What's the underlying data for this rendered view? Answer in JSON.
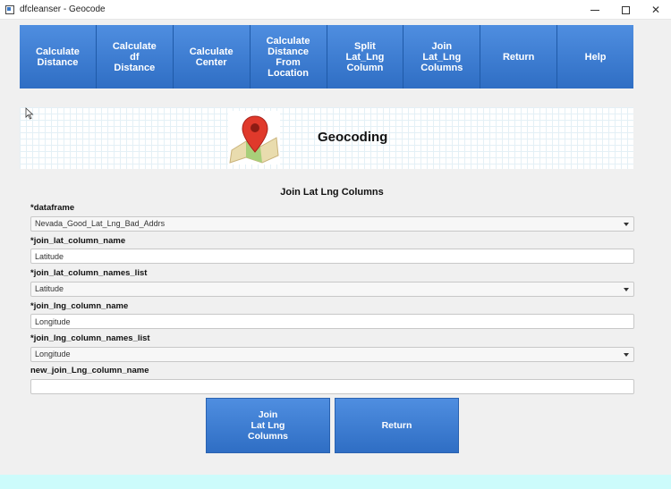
{
  "window": {
    "title": "dfcleanser - Geocode",
    "minimize": "—",
    "close": "✕"
  },
  "nav": [
    {
      "label": "Calculate\nDistance"
    },
    {
      "label": "Calculate\ndf\nDistance"
    },
    {
      "label": "Calculate\nCenter"
    },
    {
      "label": "Calculate\nDistance\nFrom\nLocation"
    },
    {
      "label": "Split\nLat_Lng\nColumn"
    },
    {
      "label": "Join\nLat_Lng\nColumns"
    },
    {
      "label": "Return"
    },
    {
      "label": "Help"
    }
  ],
  "banner": {
    "title": "Geocoding",
    "icon": "map-pin-icon"
  },
  "form": {
    "title": "Join Lat Lng Columns",
    "dataframe": {
      "label": "*dataframe",
      "value": "Nevada_Good_Lat_Lng_Bad_Addrs"
    },
    "join_lat_column_name": {
      "label": "*join_lat_column_name",
      "value": "Latitude"
    },
    "join_lat_column_names_list": {
      "label": "*join_lat_column_names_list",
      "value": "Latitude"
    },
    "join_lng_column_name": {
      "label": "*join_lng_column_name",
      "value": "Longitude"
    },
    "join_lng_column_names_list": {
      "label": "*join_lng_column_names_list",
      "value": "Longitude"
    },
    "new_join_lng_column_name": {
      "label": "new_join_Lng_column_name",
      "value": ""
    }
  },
  "actions": {
    "join": "Join\nLat Lng\nColumns",
    "return": "Return"
  },
  "colors": {
    "button_top": "#4f8ee0",
    "button_bottom": "#2f6ec4",
    "bottom_bar": "#ccfbfb"
  }
}
